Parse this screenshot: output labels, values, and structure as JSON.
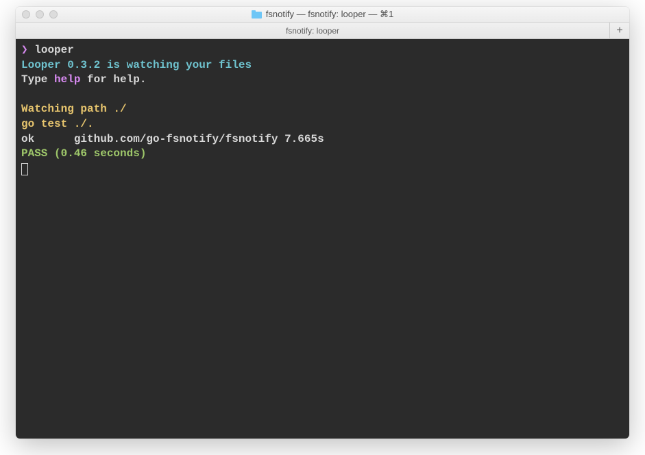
{
  "titlebar": {
    "title": "fsnotify — fsnotify: looper — ⌘1"
  },
  "tabbar": {
    "tab_label": "fsnotify: looper",
    "newtab_label": "+"
  },
  "terminal": {
    "prompt_char": "❯",
    "cmd": "looper",
    "banner": "Looper 0.3.2 is watching your files",
    "help_pre": "Type ",
    "help_word": "help",
    "help_post": " for help.",
    "watch": "Watching path ./",
    "gotest": "go test ./.",
    "ok_line": "ok  \tgithub.com/go-fsnotify/fsnotify\t7.665s",
    "pass_line": "PASS (0.46 seconds)"
  }
}
